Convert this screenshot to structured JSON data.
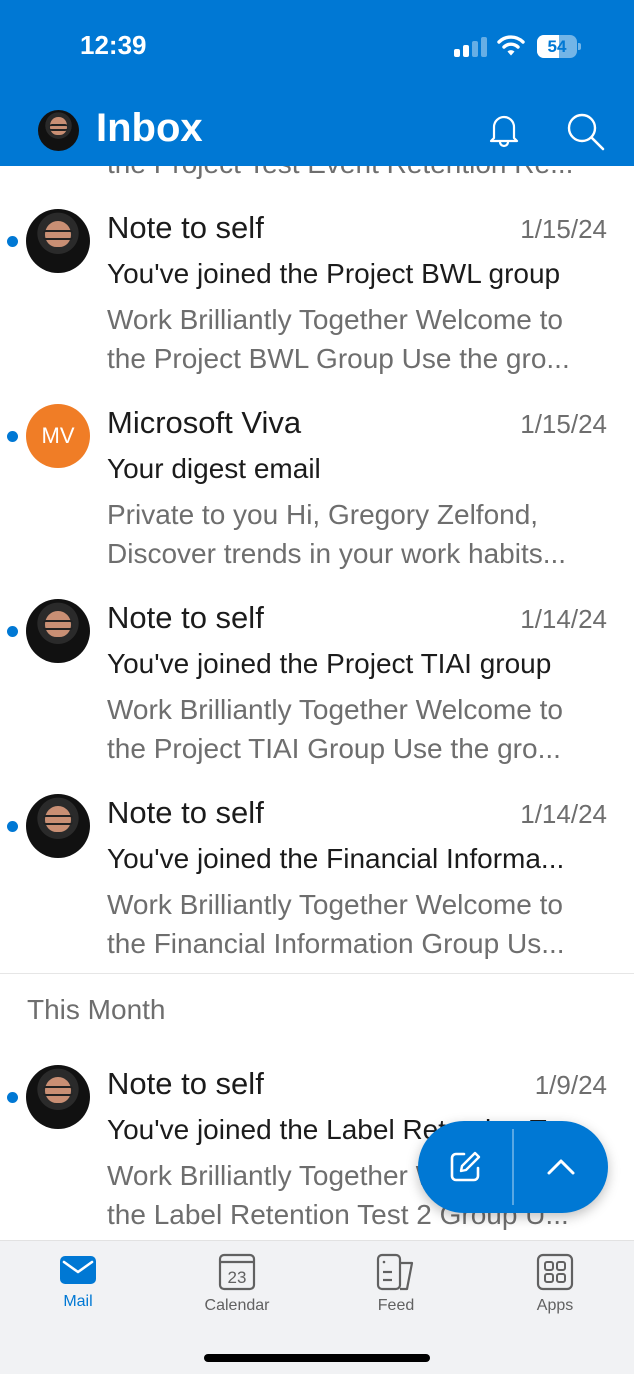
{
  "status_bar": {
    "time": "12:39",
    "battery_percent": "54",
    "battery_level": 0.54,
    "signal_bars_active": 2,
    "signal_bars_total": 4
  },
  "header": {
    "title": "Inbox",
    "icons": [
      "profile-avatar",
      "bell-icon",
      "search-icon"
    ]
  },
  "colors": {
    "accent": "#0078d4",
    "unread_dot": "#0078d4",
    "mv_avatar": "#f07d26"
  },
  "list": {
    "cut_off_preview": "the Project Test Event Retention Re...",
    "emails_top": [
      {
        "sender": "Note to self",
        "date": "1/15/24",
        "subject": "You've joined the Project BWL group",
        "preview_line1": "Work Brilliantly Together Welcome to",
        "preview_line2": "the Project BWL Group Use the gro...",
        "unread": true,
        "avatar": "photo"
      },
      {
        "sender": "Microsoft Viva",
        "date": "1/15/24",
        "subject": "Your digest email",
        "preview_line1": "Private to you Hi, Gregory Zelfond,",
        "preview_line2": "Discover trends in your work habits...",
        "unread": true,
        "avatar": "initials",
        "initials": "MV"
      },
      {
        "sender": "Note to self",
        "date": "1/14/24",
        "subject": "You've joined the Project TIAI group",
        "preview_line1": "Work Brilliantly Together Welcome to",
        "preview_line2": "the Project TIAI Group Use the gro...",
        "unread": true,
        "avatar": "photo"
      },
      {
        "sender": "Note to self",
        "date": "1/14/24",
        "subject": "You've joined the Financial Informa...",
        "preview_line1": "Work Brilliantly Together Welcome to",
        "preview_line2": "the Financial Information Group Us...",
        "unread": true,
        "avatar": "photo"
      }
    ],
    "section_this_month": "This Month",
    "emails_month": [
      {
        "sender": "Note to self",
        "date": "1/9/24",
        "subject": "You've joined the Label Retention T...",
        "preview_line1": "Work Brilliantly Together Welcome to",
        "preview_line2": "the Label Retention Test 2 Group U...",
        "unread": true,
        "avatar": "photo"
      }
    ]
  },
  "fab": {
    "compose_icon": "compose-icon",
    "scroll_top_icon": "chevron-up-icon"
  },
  "tabbar": {
    "tabs": [
      {
        "label": "Mail",
        "icon": "mail-icon",
        "active": true
      },
      {
        "label": "Calendar",
        "icon": "calendar-icon",
        "calendar_day": "23",
        "active": false
      },
      {
        "label": "Feed",
        "icon": "feed-icon",
        "active": false
      },
      {
        "label": "Apps",
        "icon": "apps-icon",
        "active": false
      }
    ]
  }
}
